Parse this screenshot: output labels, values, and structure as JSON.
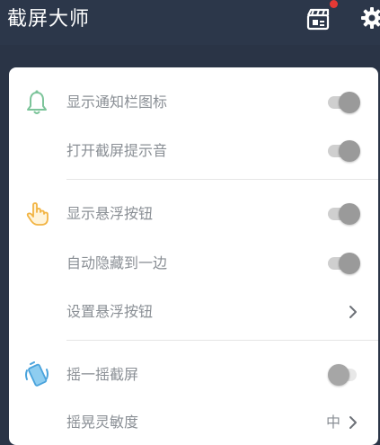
{
  "header": {
    "title": "截屏大师",
    "movie_icon": "clapperboard-icon",
    "settings_icon": "gear-icon",
    "badge_color": "#e53935"
  },
  "colors": {
    "toggle_on_knob": "#9a9a9a",
    "toggle_track": "#cfcfcf",
    "label": "#8a8f95"
  },
  "settings": {
    "notification": {
      "icon": "bell-icon",
      "show_notification_icon": {
        "label": "显示通知栏图标",
        "enabled": true
      },
      "open_screenshot_sound": {
        "label": "打开截屏提示音",
        "enabled": true
      }
    },
    "floating": {
      "icon": "hand-pointer-icon",
      "show_floating_button": {
        "label": "显示悬浮按钮",
        "enabled": true
      },
      "auto_hide_edge": {
        "label": "自动隐藏到一边",
        "enabled": true
      },
      "set_floating_button": {
        "label": "设置悬浮按钮"
      }
    },
    "shake": {
      "icon": "shake-phone-icon",
      "shake_screenshot": {
        "label": "摇一摇截屏",
        "enabled": false
      },
      "shake_sensitivity": {
        "label": "摇晃灵敏度",
        "value": "中"
      }
    }
  }
}
